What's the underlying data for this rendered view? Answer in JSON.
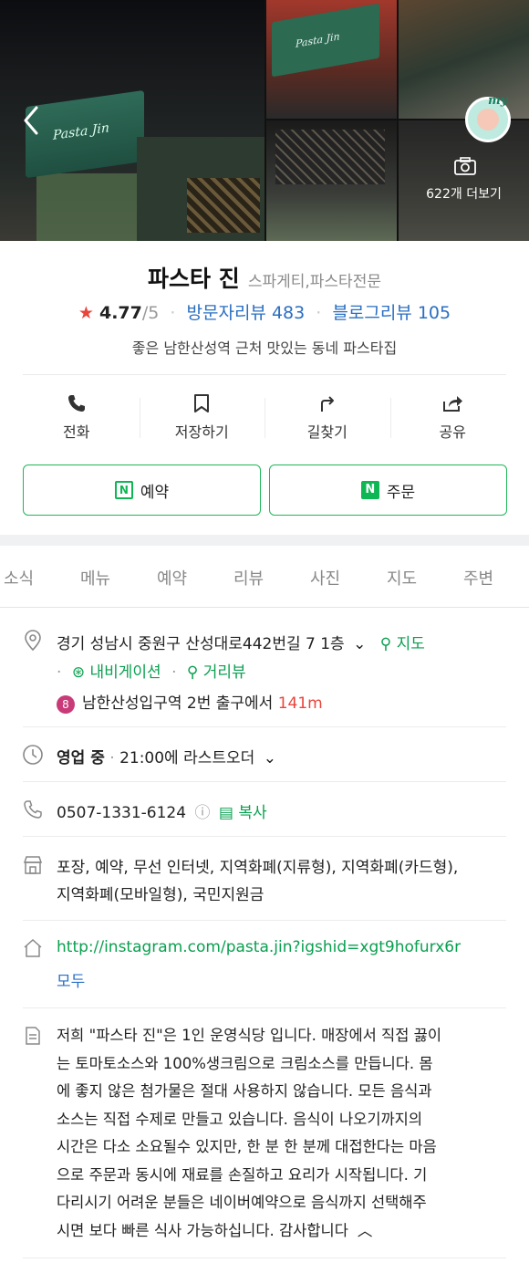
{
  "photos": {
    "more_label": "622개 더보기",
    "sign_text": "Pasta Jin",
    "my_label": "my"
  },
  "place": {
    "name": "파스타 진",
    "category": "스파게티,파스타전문",
    "rating": "4.77",
    "rating_max": "/5",
    "visitor_reviews": "방문자리뷰 483",
    "blog_reviews": "블로그리뷰 105",
    "description": "좋은 남한산성역 근처 맛있는 동네 파스타집"
  },
  "actions": [
    {
      "label": "전화",
      "icon": "phone-icon"
    },
    {
      "label": "저장하기",
      "icon": "bookmark-icon"
    },
    {
      "label": "길찾기",
      "icon": "directions-icon"
    },
    {
      "label": "공유",
      "icon": "share-icon"
    }
  ],
  "buttons": {
    "reserve": "예약",
    "order": "주문",
    "n_badge": "N"
  },
  "tabs": [
    "소식",
    "메뉴",
    "예약",
    "리뷰",
    "사진",
    "지도",
    "주변"
  ],
  "info": {
    "address": "경기 성남시 중원구 산성대로442번길 7 1층",
    "map_link": "지도",
    "navigation": "내비게이션",
    "street_view": "거리뷰",
    "subway_line": "8",
    "subway_station": "남한산성입구역",
    "subway_exit": "2번 출구에서",
    "subway_distance": "141m",
    "hours_status": "영업 중",
    "hours_detail": "21:00에 라스트오더",
    "phone": "0507-1331-6124",
    "copy": "복사",
    "amenities_line1": "포장, 예약, 무선 인터넷, 지역화폐(지류형), 지역화폐(카드형),",
    "amenities_line2": "지역화폐(모바일형), 국민지원금",
    "website": "http://instagram.com/pasta.jin?igshid=xgt9hofurx6r",
    "website_more": "모두",
    "description_lines": [
      "저희 \"파스타 진\"은 1인 운영식당 입니다. 매장에서 직접 끓이",
      "는 토마토소스와 100%생크림으로 크림소스를 만듭니다. 몸",
      "에 좋지 않은 첨가물은 절대 사용하지 않습니다. 모든 음식과",
      "소스는 직접 수제로 만들고 있습니다. 음식이 나오기까지의",
      "시간은 다소 소요될수 있지만, 한 분 한 분께 대접한다는 마음",
      "으로 주문과 동시에 재료를 손질하고 요리가 시작됩니다. 기",
      "다리시기 어려운 분들은 네이버예약으로 음식까지 선택해주",
      "시면 보다 빠른 식사 가능하십니다. 감사합니다"
    ]
  },
  "colors": {
    "naver_green": "#0fb654",
    "link_blue": "#2a6fc2",
    "star_red": "#e8453c",
    "line8_pink": "#c93a78"
  }
}
